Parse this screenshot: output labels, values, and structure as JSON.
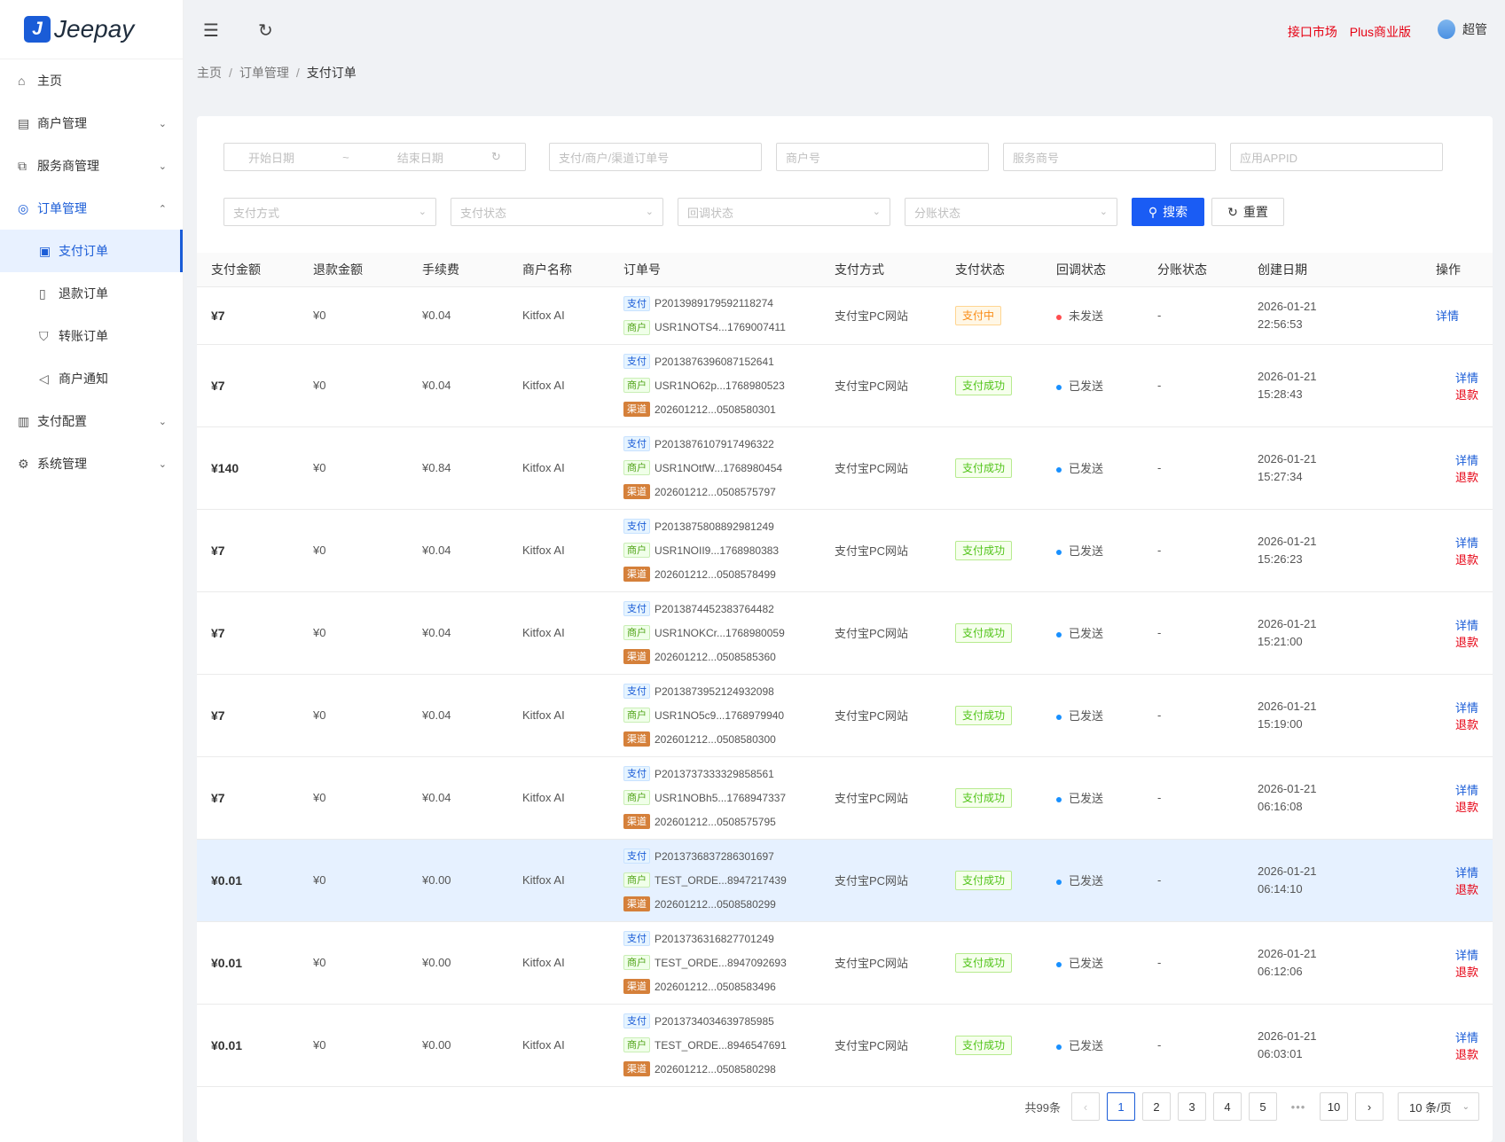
{
  "app": {
    "logo_mark": "J",
    "logo_text": "Jeepay"
  },
  "sidebar": {
    "items": [
      {
        "label": "主页",
        "icon": "home-icon"
      },
      {
        "label": "商户管理",
        "icon": "shop-icon"
      },
      {
        "label": "服务商管理",
        "icon": "partner-icon"
      },
      {
        "label": "订单管理",
        "icon": "order-icon"
      },
      {
        "label": "支付订单",
        "icon": "pay-order-icon"
      },
      {
        "label": "退款订单",
        "icon": "refund-order-icon"
      },
      {
        "label": "转账订单",
        "icon": "transfer-order-icon"
      },
      {
        "label": "商户通知",
        "icon": "notify-icon"
      },
      {
        "label": "支付配置",
        "icon": "pay-config-icon"
      },
      {
        "label": "系统管理",
        "icon": "settings-icon"
      }
    ]
  },
  "topbar": {
    "link1": "接口市场",
    "link2": "Plus商业版",
    "user": "超管",
    "accent": "#e60012"
  },
  "breadcrumb": {
    "home": "主页",
    "parent": "订单管理",
    "current": "支付订单"
  },
  "filters": {
    "start_date": "开始日期",
    "tilde": "~",
    "end_date": "结束日期",
    "order_no": "支付/商户/渠道订单号",
    "mch_no": "商户号",
    "isv_no": "服务商号",
    "app_id": "应用APPID",
    "way": "支付方式",
    "state": "支付状态",
    "notify_state": "回调状态",
    "div_state": "分账状态",
    "search": "搜索",
    "reset": "重置"
  },
  "table": {
    "headers": [
      "支付金额",
      "退款金额",
      "手续费",
      "商户名称",
      "订单号",
      "支付方式",
      "支付状态",
      "回调状态",
      "分账状态",
      "创建日期",
      "操作"
    ],
    "tag_pay": "支付",
    "tag_mch": "商户",
    "tag_ch": "渠道",
    "detail": "详情",
    "refund": "退款",
    "rows": [
      {
        "amount": "¥7",
        "refund": "¥0",
        "fee": "¥0.04",
        "mch": "Kitfox AI",
        "pay_no": "P2013989179592118274",
        "mch_no": "USR1NOTS4...1769007411",
        "ch_no": "",
        "way": "支付宝PC网站",
        "state": "支付中",
        "notify": "未发送",
        "div": "-",
        "date": "2026-01-21",
        "time": "22:56:53"
      },
      {
        "amount": "¥7",
        "refund": "¥0",
        "fee": "¥0.04",
        "mch": "Kitfox AI",
        "pay_no": "P2013876396087152641",
        "mch_no": "USR1NO62p...1768980523",
        "ch_no": "202601212...0508580301",
        "way": "支付宝PC网站",
        "state": "支付成功",
        "notify": "已发送",
        "div": "-",
        "date": "2026-01-21",
        "time": "15:28:43"
      },
      {
        "amount": "¥140",
        "refund": "¥0",
        "fee": "¥0.84",
        "mch": "Kitfox AI",
        "pay_no": "P2013876107917496322",
        "mch_no": "USR1NOtfW...1768980454",
        "ch_no": "202601212...0508575797",
        "way": "支付宝PC网站",
        "state": "支付成功",
        "notify": "已发送",
        "div": "-",
        "date": "2026-01-21",
        "time": "15:27:34"
      },
      {
        "amount": "¥7",
        "refund": "¥0",
        "fee": "¥0.04",
        "mch": "Kitfox AI",
        "pay_no": "P2013875808892981249",
        "mch_no": "USR1NOII9...1768980383",
        "ch_no": "202601212...0508578499",
        "way": "支付宝PC网站",
        "state": "支付成功",
        "notify": "已发送",
        "div": "-",
        "date": "2026-01-21",
        "time": "15:26:23"
      },
      {
        "amount": "¥7",
        "refund": "¥0",
        "fee": "¥0.04",
        "mch": "Kitfox AI",
        "pay_no": "P2013874452383764482",
        "mch_no": "USR1NOKCr...1768980059",
        "ch_no": "202601212...0508585360",
        "way": "支付宝PC网站",
        "state": "支付成功",
        "notify": "已发送",
        "div": "-",
        "date": "2026-01-21",
        "time": "15:21:00"
      },
      {
        "amount": "¥7",
        "refund": "¥0",
        "fee": "¥0.04",
        "mch": "Kitfox AI",
        "pay_no": "P2013873952124932098",
        "mch_no": "USR1NO5c9...1768979940",
        "ch_no": "202601212...0508580300",
        "way": "支付宝PC网站",
        "state": "支付成功",
        "notify": "已发送",
        "div": "-",
        "date": "2026-01-21",
        "time": "15:19:00"
      },
      {
        "amount": "¥7",
        "refund": "¥0",
        "fee": "¥0.04",
        "mch": "Kitfox AI",
        "pay_no": "P2013737333329858561",
        "mch_no": "USR1NOBh5...1768947337",
        "ch_no": "202601212...0508575795",
        "way": "支付宝PC网站",
        "state": "支付成功",
        "notify": "已发送",
        "div": "-",
        "date": "2026-01-21",
        "time": "06:16:08"
      },
      {
        "amount": "¥0.01",
        "refund": "¥0",
        "fee": "¥0.00",
        "mch": "Kitfox AI",
        "pay_no": "P2013736837286301697",
        "mch_no": "TEST_ORDE...8947217439",
        "ch_no": "202601212...0508580299",
        "way": "支付宝PC网站",
        "state": "支付成功",
        "notify": "已发送",
        "div": "-",
        "date": "2026-01-21",
        "time": "06:14:10"
      },
      {
        "amount": "¥0.01",
        "refund": "¥0",
        "fee": "¥0.00",
        "mch": "Kitfox AI",
        "pay_no": "P2013736316827701249",
        "mch_no": "TEST_ORDE...8947092693",
        "ch_no": "202601212...0508583496",
        "way": "支付宝PC网站",
        "state": "支付成功",
        "notify": "已发送",
        "div": "-",
        "date": "2026-01-21",
        "time": "06:12:06"
      },
      {
        "amount": "¥0.01",
        "refund": "¥0",
        "fee": "¥0.00",
        "mch": "Kitfox AI",
        "pay_no": "P2013734034639785985",
        "mch_no": "TEST_ORDE...8946547691",
        "ch_no": "202601212...0508580298",
        "way": "支付宝PC网站",
        "state": "支付成功",
        "notify": "已发送",
        "div": "-",
        "date": "2026-01-21",
        "time": "06:03:01"
      }
    ]
  },
  "pagination": {
    "total": "共99条",
    "pages": [
      "1",
      "2",
      "3",
      "4",
      "5"
    ],
    "ellipsis": "•••",
    "last": "10",
    "prev": "‹",
    "next": "›",
    "page_size": "10 条/页"
  }
}
